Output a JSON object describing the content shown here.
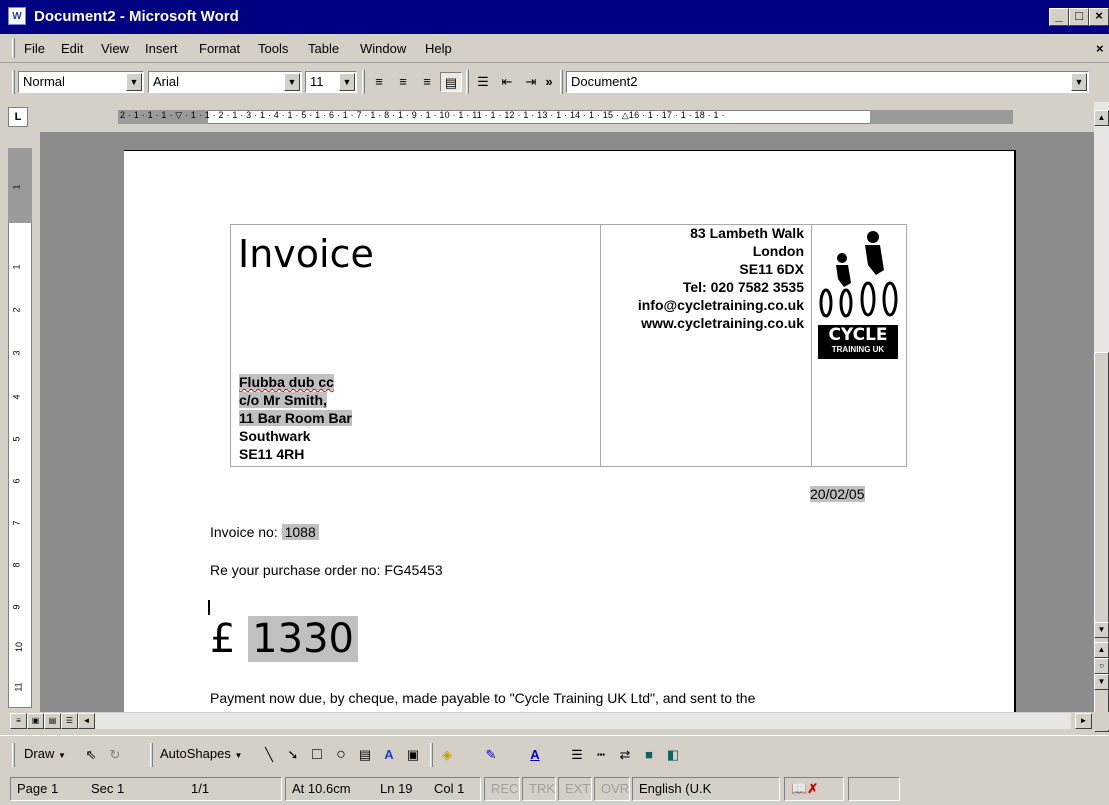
{
  "window": {
    "title": "Document2 - Microsoft Word",
    "icon": "W",
    "controls": [
      "_",
      "□",
      "×"
    ]
  },
  "menubar": {
    "items": [
      "File",
      "Edit",
      "View",
      "Insert",
      "Format",
      "Tools",
      "Table",
      "Window",
      "Help"
    ],
    "close_doc": "×"
  },
  "formatting": {
    "style": "Normal",
    "font": "Arial",
    "size": "11",
    "more": "»",
    "document": "Document2"
  },
  "ruler": {
    "tab_selector": "L",
    "marks": "2 · 1 · 1 · 1 · ▽ · 1 · 1 · 2 · 1 · 3 · 1 · 4 · 1 · 5 · 1 · 6 · 1 · 7 · 1 · 8 · 1 · 9 · 1 · 10 · 1 · 11 · 1 · 12 · 1 · 13 · 1 · 14 · 1 · 15 · △16 · 1 · 17 · 1 · 18 · 1 ·",
    "vertical_numbers": [
      "1",
      "1",
      "2",
      "3",
      "4",
      "5",
      "6",
      "7",
      "8",
      "9",
      "10",
      "11"
    ]
  },
  "document": {
    "heading": "Invoice",
    "company_address": [
      "83 Lambeth Walk",
      "London",
      "SE11 6DX",
      "Tel: 020 7582 3535",
      "info@cycletraining.co.uk",
      "www.cycletraining.co.uk"
    ],
    "logo_text": "CYCLE",
    "logo_subtext": "TRAINING UK",
    "customer_address": [
      "Flubba dub cc",
      "c/o Mr Smith,",
      "11 Bar Room Bar",
      "Southwark",
      "SE11 4RH"
    ],
    "date": "20/02/05",
    "invoice_label": "Invoice no:",
    "invoice_no": "1088",
    "po_line": "Re your purchase order no: FG45453",
    "currency": "£",
    "amount": "1330",
    "payment_text": "Payment now due, by cheque, made payable to \"Cycle Training UK Ltd\", and sent to the"
  },
  "drawing": {
    "draw": "Draw",
    "autoshapes": "AutoShapes"
  },
  "status": {
    "page": "Page 1",
    "sec": "Sec 1",
    "pages": "1/1",
    "at": "At 10.6cm",
    "ln": "Ln 19",
    "col": "Col 1",
    "rec": "REC",
    "trk": "TRK",
    "ext": "EXT",
    "ovr": "OVR",
    "language": "English (U.K"
  },
  "colors": {
    "titlebar": "#000080",
    "chrome": "#d4d0c8",
    "workspace": "#8c8c8c",
    "field_highlight": "#c0c0c0"
  }
}
